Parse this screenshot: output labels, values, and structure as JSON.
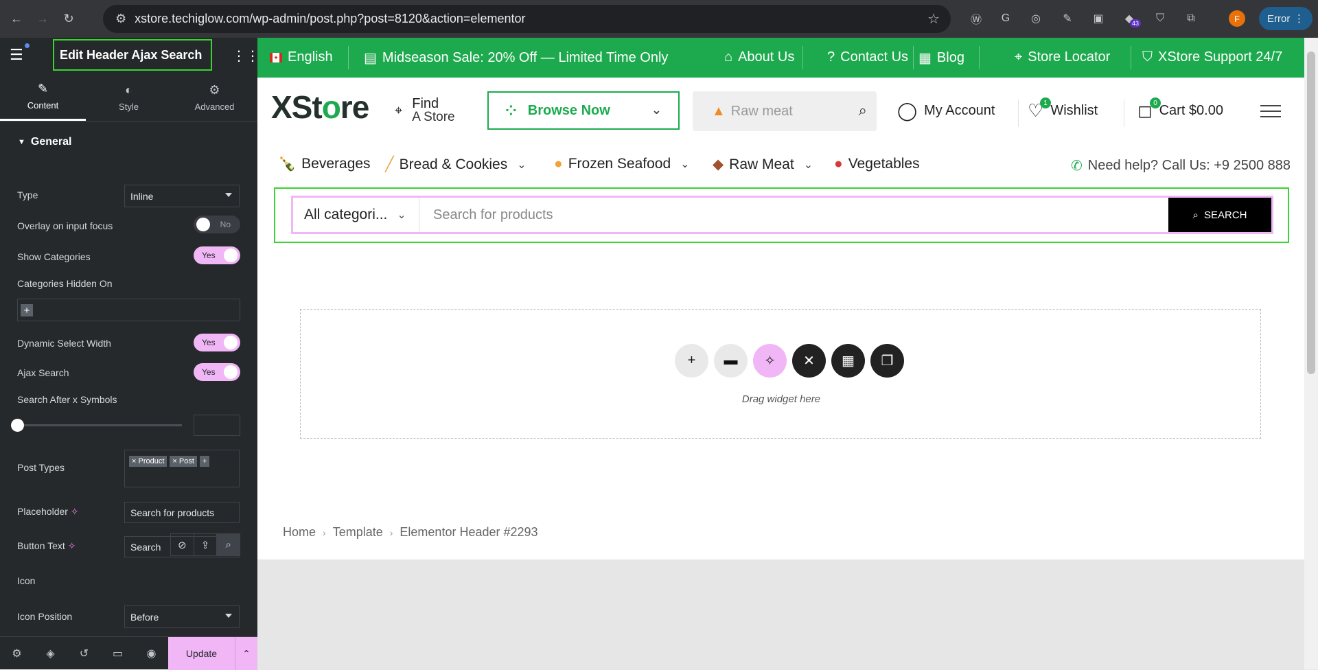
{
  "browser": {
    "url": "xstore.techiglow.com/wp-admin/post.php?post=8120&action=elementor",
    "ext_badge": "43",
    "profile_initial": "F",
    "error_label": "Error"
  },
  "panel": {
    "title": "Edit Header Ajax Search",
    "tabs": [
      {
        "label": "Content"
      },
      {
        "label": "Style"
      },
      {
        "label": "Advanced"
      }
    ],
    "section": "General",
    "type_label": "Type",
    "type_value": "Inline",
    "overlay_label": "Overlay on input focus",
    "overlay_value": "No",
    "show_categories_label": "Show Categories",
    "show_categories_value": "Yes",
    "categories_hidden_label": "Categories Hidden On",
    "dynamic_width_label": "Dynamic Select Width",
    "dynamic_width_value": "Yes",
    "ajax_search_label": "Ajax Search",
    "ajax_search_value": "Yes",
    "search_after_label": "Search After x Symbols",
    "post_types_label": "Post Types",
    "post_types": [
      "× Product",
      "× Post"
    ],
    "placeholder_label": "Placeholder",
    "placeholder_value": "Search for products",
    "button_text_label": "Button Text",
    "button_text_value": "Search",
    "icon_label": "Icon",
    "icon_position_label": "Icon Position",
    "icon_position_value": "Before",
    "update_label": "Update"
  },
  "site": {
    "topbar": {
      "language": "English",
      "promo": "Midseason Sale: 20% Off — Limited Time Only",
      "about": "About Us",
      "contact": "Contact Us",
      "blog": "Blog",
      "locator": "Store Locator",
      "support": "XStore Support 24/7"
    },
    "header": {
      "logo_a": "XSt",
      "logo_b": "o",
      "logo_c": "re",
      "find_1": "Find",
      "find_2": "A Store",
      "browse": "Browse Now",
      "search_ph": "Raw meat",
      "account": "My Account",
      "wishlist": "Wishlist",
      "wishlist_count": "1",
      "cart": "Cart $0.00",
      "cart_count": "0"
    },
    "menu": {
      "items": [
        "Beverages",
        "Bread & Cookies",
        "Frozen Seafood",
        "Raw Meat",
        "Vegetables"
      ],
      "help": "Need help? Call Us: +9 2500 888"
    },
    "search": {
      "category": "All categori...",
      "placeholder": "Search for products",
      "button": "SEARCH"
    },
    "dropzone_text": "Drag widget here",
    "breadcrumbs": [
      "Home",
      "Template",
      "Elementor Header #2293"
    ]
  }
}
